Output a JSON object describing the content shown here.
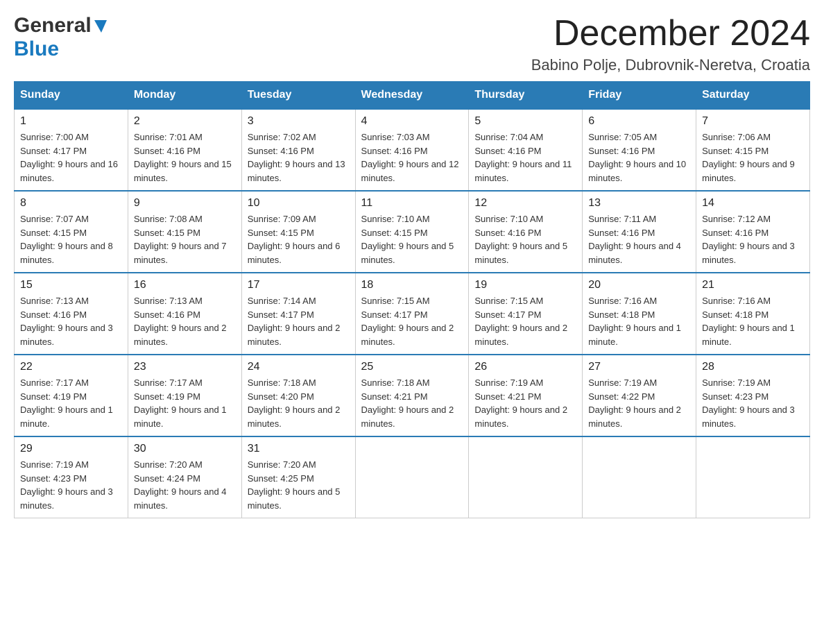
{
  "logo": {
    "general": "General",
    "blue": "Blue"
  },
  "title": {
    "month_year": "December 2024",
    "location": "Babino Polje, Dubrovnik-Neretva, Croatia"
  },
  "days_of_week": [
    "Sunday",
    "Monday",
    "Tuesday",
    "Wednesday",
    "Thursday",
    "Friday",
    "Saturday"
  ],
  "weeks": [
    [
      {
        "day": "1",
        "sunrise": "7:00 AM",
        "sunset": "4:17 PM",
        "daylight": "9 hours and 16 minutes."
      },
      {
        "day": "2",
        "sunrise": "7:01 AM",
        "sunset": "4:16 PM",
        "daylight": "9 hours and 15 minutes."
      },
      {
        "day": "3",
        "sunrise": "7:02 AM",
        "sunset": "4:16 PM",
        "daylight": "9 hours and 13 minutes."
      },
      {
        "day": "4",
        "sunrise": "7:03 AM",
        "sunset": "4:16 PM",
        "daylight": "9 hours and 12 minutes."
      },
      {
        "day": "5",
        "sunrise": "7:04 AM",
        "sunset": "4:16 PM",
        "daylight": "9 hours and 11 minutes."
      },
      {
        "day": "6",
        "sunrise": "7:05 AM",
        "sunset": "4:16 PM",
        "daylight": "9 hours and 10 minutes."
      },
      {
        "day": "7",
        "sunrise": "7:06 AM",
        "sunset": "4:15 PM",
        "daylight": "9 hours and 9 minutes."
      }
    ],
    [
      {
        "day": "8",
        "sunrise": "7:07 AM",
        "sunset": "4:15 PM",
        "daylight": "9 hours and 8 minutes."
      },
      {
        "day": "9",
        "sunrise": "7:08 AM",
        "sunset": "4:15 PM",
        "daylight": "9 hours and 7 minutes."
      },
      {
        "day": "10",
        "sunrise": "7:09 AM",
        "sunset": "4:15 PM",
        "daylight": "9 hours and 6 minutes."
      },
      {
        "day": "11",
        "sunrise": "7:10 AM",
        "sunset": "4:15 PM",
        "daylight": "9 hours and 5 minutes."
      },
      {
        "day": "12",
        "sunrise": "7:10 AM",
        "sunset": "4:16 PM",
        "daylight": "9 hours and 5 minutes."
      },
      {
        "day": "13",
        "sunrise": "7:11 AM",
        "sunset": "4:16 PM",
        "daylight": "9 hours and 4 minutes."
      },
      {
        "day": "14",
        "sunrise": "7:12 AM",
        "sunset": "4:16 PM",
        "daylight": "9 hours and 3 minutes."
      }
    ],
    [
      {
        "day": "15",
        "sunrise": "7:13 AM",
        "sunset": "4:16 PM",
        "daylight": "9 hours and 3 minutes."
      },
      {
        "day": "16",
        "sunrise": "7:13 AM",
        "sunset": "4:16 PM",
        "daylight": "9 hours and 2 minutes."
      },
      {
        "day": "17",
        "sunrise": "7:14 AM",
        "sunset": "4:17 PM",
        "daylight": "9 hours and 2 minutes."
      },
      {
        "day": "18",
        "sunrise": "7:15 AM",
        "sunset": "4:17 PM",
        "daylight": "9 hours and 2 minutes."
      },
      {
        "day": "19",
        "sunrise": "7:15 AM",
        "sunset": "4:17 PM",
        "daylight": "9 hours and 2 minutes."
      },
      {
        "day": "20",
        "sunrise": "7:16 AM",
        "sunset": "4:18 PM",
        "daylight": "9 hours and 1 minute."
      },
      {
        "day": "21",
        "sunrise": "7:16 AM",
        "sunset": "4:18 PM",
        "daylight": "9 hours and 1 minute."
      }
    ],
    [
      {
        "day": "22",
        "sunrise": "7:17 AM",
        "sunset": "4:19 PM",
        "daylight": "9 hours and 1 minute."
      },
      {
        "day": "23",
        "sunrise": "7:17 AM",
        "sunset": "4:19 PM",
        "daylight": "9 hours and 1 minute."
      },
      {
        "day": "24",
        "sunrise": "7:18 AM",
        "sunset": "4:20 PM",
        "daylight": "9 hours and 2 minutes."
      },
      {
        "day": "25",
        "sunrise": "7:18 AM",
        "sunset": "4:21 PM",
        "daylight": "9 hours and 2 minutes."
      },
      {
        "day": "26",
        "sunrise": "7:19 AM",
        "sunset": "4:21 PM",
        "daylight": "9 hours and 2 minutes."
      },
      {
        "day": "27",
        "sunrise": "7:19 AM",
        "sunset": "4:22 PM",
        "daylight": "9 hours and 2 minutes."
      },
      {
        "day": "28",
        "sunrise": "7:19 AM",
        "sunset": "4:23 PM",
        "daylight": "9 hours and 3 minutes."
      }
    ],
    [
      {
        "day": "29",
        "sunrise": "7:19 AM",
        "sunset": "4:23 PM",
        "daylight": "9 hours and 3 minutes."
      },
      {
        "day": "30",
        "sunrise": "7:20 AM",
        "sunset": "4:24 PM",
        "daylight": "9 hours and 4 minutes."
      },
      {
        "day": "31",
        "sunrise": "7:20 AM",
        "sunset": "4:25 PM",
        "daylight": "9 hours and 5 minutes."
      },
      null,
      null,
      null,
      null
    ]
  ]
}
